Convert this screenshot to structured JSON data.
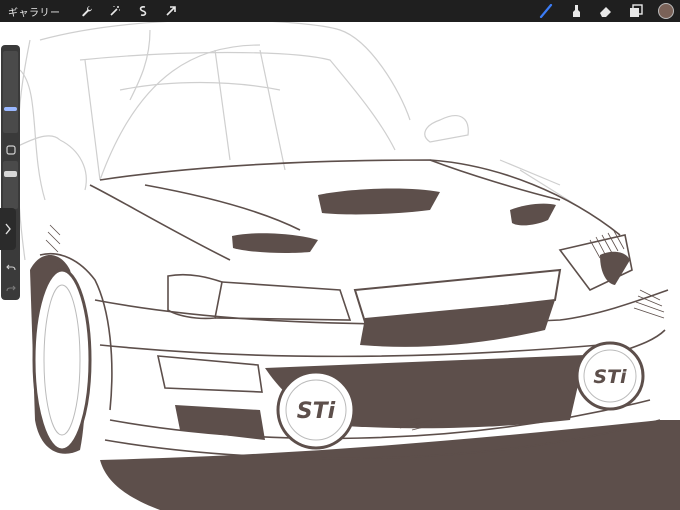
{
  "toolbar": {
    "gallery_label": "ギャラリー",
    "left_icons": [
      "wrench-icon",
      "magic-wand-icon",
      "selection-icon",
      "transform-arrow-icon"
    ],
    "right_icons": [
      "brush-icon",
      "smudge-icon",
      "eraser-icon",
      "layers-icon"
    ],
    "current_color": "#7a6258",
    "active_tool_color": "#3b7cf6"
  },
  "canvas": {
    "ink_color": "#5d4f4b",
    "sketch_color": "#c8c8c8",
    "badge_text": "STi"
  },
  "sidebar": {
    "brush_size_level": 0.74,
    "opacity_level": 0.6
  }
}
